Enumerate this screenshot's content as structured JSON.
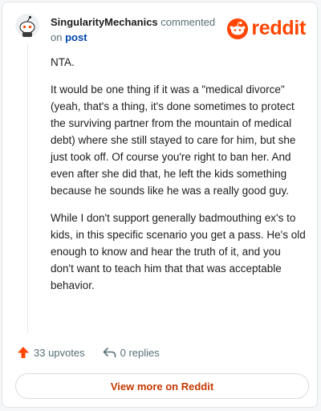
{
  "header": {
    "username": "SingularityMechanics",
    "action_text": "commented",
    "preposition": "on",
    "post_link": "post"
  },
  "logo": {
    "word": "reddit",
    "color": "#ff4500"
  },
  "comment": {
    "paragraphs": [
      "NTA.",
      "It would be one thing if it was a \"medical divorce\" (yeah, that's a thing, it's done sometimes to protect the surviving partner from the mountain of medical debt) where she still stayed to care for him, but she just took off. Of course you're right to ban her. And even after she did that, he left the kids something because he sounds like he was a really good guy.",
      "While I don't support generally badmouthing ex's to kids, in this specific scenario you get a pass. He's old enough to know and hear the truth of it, and you don't want to teach him that that was acceptable behavior."
    ]
  },
  "actions": {
    "upvote_icon": "upvote-arrow-icon",
    "upvotes": "33 upvotes",
    "reply_icon": "reply-icon",
    "replies": "0 replies"
  },
  "footer": {
    "view_more": "View more on Reddit"
  },
  "colors": {
    "accent": "#ff4500",
    "link": "#0045ac",
    "muted": "#576f76"
  }
}
